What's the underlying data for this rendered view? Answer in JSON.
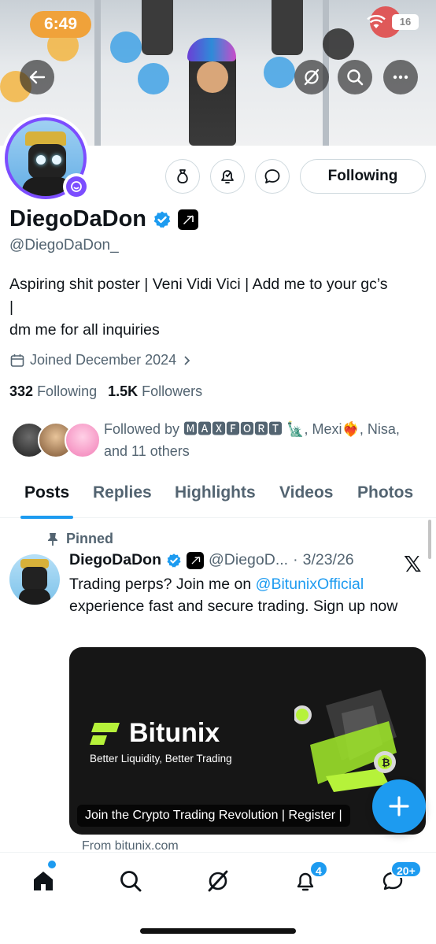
{
  "status_bar": {
    "time": "6:49",
    "battery": "16"
  },
  "header": {
    "back_icon": "arrow-left-icon",
    "grok_icon": "grok-icon",
    "search_icon": "search-icon",
    "more_icon": "more-icon"
  },
  "profile": {
    "display_name": "DiegoDaDon",
    "handle": "@DiegoDaDon_",
    "bio_line1": "Aspiring shit poster | Veni Vidi Vici | Add me to your gc’s",
    "bio_line2": "|",
    "bio_line3": "dm me for all inquiries",
    "joined": "Joined December 2024",
    "following_count": "332",
    "following_label": "Following",
    "followers_count": "1.5K",
    "followers_label": "Followers",
    "followed_by": "Followed by 🅼🅰🆇🅵🅾🆁🆃 🗽, Mexi❤️‍🔥, Nisa,",
    "followed_by_more": "and 11 others",
    "following_button": "Following"
  },
  "tabs": [
    "Posts",
    "Replies",
    "Highlights",
    "Videos",
    "Photos"
  ],
  "post": {
    "pinned_label": "Pinned",
    "author_name": "DiegoDaDon",
    "author_handle": "@DiegoD...",
    "dot": "·",
    "date": "3/23/26",
    "text_before": "Trading perps? Join me on ",
    "mention": "@BitunixOfficial",
    "text_after": " experience fast and secure trading. Sign up now",
    "card": {
      "brand": "Bitunix",
      "tagline": "Better Liquidity, Better Trading",
      "overlay": "Join the Crypto Trading Revolution | Register |"
    },
    "from": "From bitunix.com"
  },
  "bottom_nav": {
    "notifications_badge": "4",
    "messages_badge": "20+"
  },
  "colors": {
    "accent": "#1d9bf0",
    "ring": "#7c4dff",
    "time_pill": "#f0a23a"
  }
}
